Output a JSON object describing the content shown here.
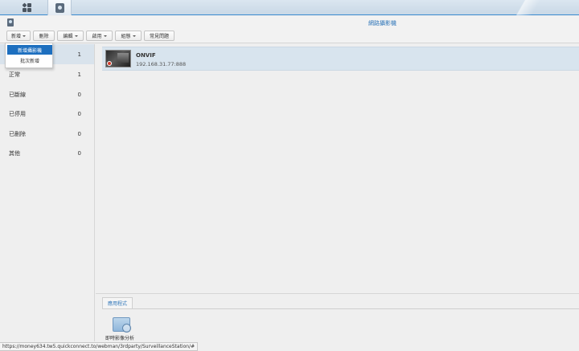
{
  "taskbar": {
    "home_icon": "grid-icon",
    "app_icon": "surveillance-station-icon"
  },
  "header": {
    "title": "網路攝影機"
  },
  "toolbar": {
    "add": "新增",
    "delete": "刪除",
    "edit": "編輯",
    "enable": "啟用",
    "config": "組態",
    "faq": "常見問題"
  },
  "add_menu": {
    "items": [
      "新增攝影機",
      "批次新增"
    ]
  },
  "categories": [
    {
      "label": "",
      "count": "1"
    },
    {
      "label": "正常",
      "count": "1"
    },
    {
      "label": "已斷線",
      "count": "0"
    },
    {
      "label": "已停用",
      "count": "0"
    },
    {
      "label": "已刪除",
      "count": "0"
    },
    {
      "label": "其他",
      "count": "0"
    }
  ],
  "cameras": [
    {
      "name": "ONVIF",
      "address": "192.168.31.77:888"
    }
  ],
  "apps_panel": {
    "tab": "應用程式",
    "apps": [
      {
        "label": "即時影像分析",
        "icon": "video-analytics-icon"
      }
    ]
  },
  "status_bar": {
    "url": "https://money634.tw5.quickconnect.to/webman/3rdparty/SurveillanceStation/#"
  },
  "colors": {
    "accent": "#2c74b8",
    "menu_highlight": "#1d6fbf",
    "recording": "#d23a2a"
  }
}
